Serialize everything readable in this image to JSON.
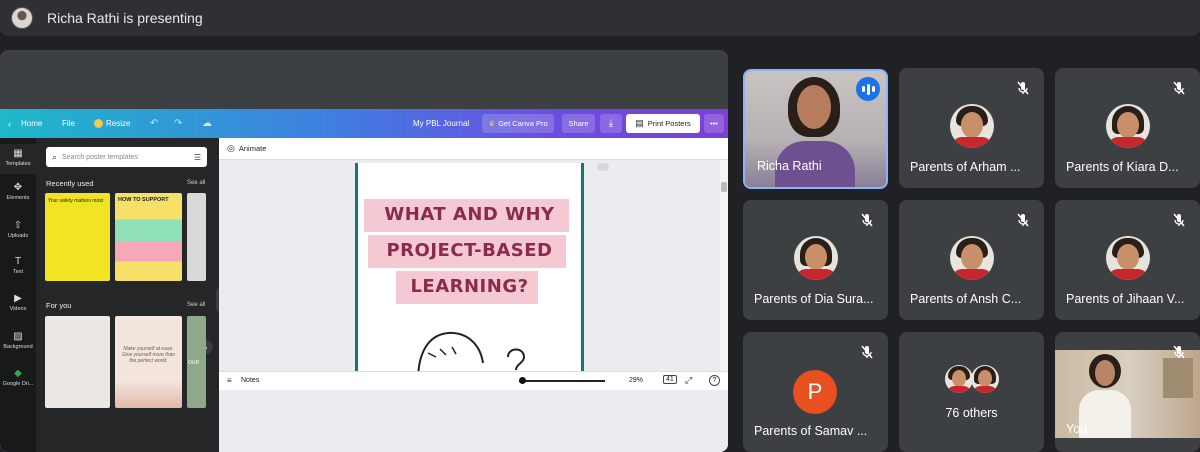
{
  "presenter_bar": {
    "title": "Richa Rathi is presenting"
  },
  "canva": {
    "topbar": {
      "home": "Home",
      "file": "File",
      "resize": "Resize",
      "doc_title": "My PBL Journal",
      "get_pro": "Get Canva Pro",
      "share": "Share",
      "print": "Print Posters",
      "more": "•••"
    },
    "rail": [
      {
        "label": "Templates",
        "icon": "templates-icon",
        "glyph": "▦"
      },
      {
        "label": "Elements",
        "icon": "elements-icon",
        "glyph": "✥"
      },
      {
        "label": "Uploads",
        "icon": "uploads-icon",
        "glyph": "⇧"
      },
      {
        "label": "Text",
        "icon": "text-icon",
        "glyph": "T"
      },
      {
        "label": "Videos",
        "icon": "videos-icon",
        "glyph": "▶"
      },
      {
        "label": "Background",
        "icon": "background-icon",
        "glyph": "▨"
      },
      {
        "label": "Google Dri...",
        "icon": "google-drive-icon",
        "glyph": "◆"
      }
    ],
    "panel": {
      "search_placeholder": "Search poster templates",
      "recently_used": "Recently used",
      "for_you": "For you",
      "see_all": "See all",
      "recent_thumb_texts": [
        "Your safety matters most",
        "HOW TO SUPPORT"
      ],
      "foryou_thumb_texts": [
        "Make yourself at ease. Give yourself more than the perfect world.",
        "OUR"
      ]
    },
    "workspace": {
      "animate": "Animate",
      "headline_lines": [
        "WHAT AND WHY",
        "PROJECT-BASED",
        "LEARNING?"
      ],
      "notes": "Notes",
      "zoom": "29%",
      "page_count": "41",
      "help": "?"
    }
  },
  "participants": [
    {
      "name": "Richa Rathi",
      "speaking": true,
      "type": "video"
    },
    {
      "name": "Parents of Arham ...",
      "muted": true,
      "type": "photo"
    },
    {
      "name": "Parents of Kiara D...",
      "muted": true,
      "type": "photo"
    },
    {
      "name": "Parents of Dia Sura...",
      "muted": true,
      "type": "photo"
    },
    {
      "name": "Parents of Ansh C...",
      "muted": true,
      "type": "photo"
    },
    {
      "name": "Parents of Jihaan V...",
      "muted": true,
      "type": "photo"
    },
    {
      "name": "Parents of Samav ...",
      "muted": true,
      "type": "initial",
      "initial": "P",
      "color": "#e8501f"
    },
    {
      "name": "76 others",
      "type": "others"
    },
    {
      "name": "You",
      "muted": true,
      "type": "self-video"
    }
  ],
  "colors": {
    "meet_bg": "#202124",
    "tile_bg": "#3c4043",
    "active_border": "#8ab4f8",
    "speaking": "#1a73e8",
    "headline": "#8b2a4f",
    "headline_bg": "#f4c9d3"
  }
}
